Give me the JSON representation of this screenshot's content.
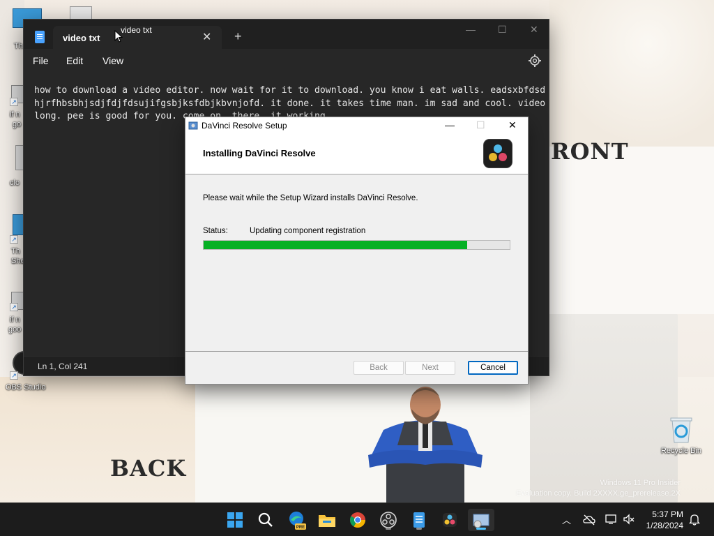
{
  "desktop": {
    "poster_front": "RONT",
    "poster_back": "BACK",
    "watermark_line1": "Windows 11 Pro Insider",
    "watermark_line2": "Evaluation copy. Build 2XXXX.ge_prerelease.2X",
    "icons": [
      {
        "label": "Th",
        "name": "desktop-icon-th"
      },
      {
        "label": "if n",
        "name": "desktop-icon-if-n-1"
      },
      {
        "label": "go",
        "name": "desktop-icon-go-1"
      },
      {
        "label": "clo",
        "name": "desktop-icon-clo"
      },
      {
        "label": "Th",
        "name": "desktop-icon-th-2"
      },
      {
        "label": "She",
        "name": "desktop-icon-she"
      },
      {
        "label": "if n",
        "name": "desktop-icon-if-n-2"
      },
      {
        "label": "goo",
        "name": "desktop-icon-goo-2"
      },
      {
        "label": "OBS Studio",
        "name": "desktop-icon-obs"
      }
    ],
    "recycle_bin_label": "Recycle Bin"
  },
  "notepad": {
    "tab_title": "video txt",
    "tooltip": "video txt",
    "menu": [
      "File",
      "Edit",
      "View"
    ],
    "content": "how to download a video editor. now wait for it to download. you know i eat walls. eadsxbfdsdhjrfhbsbhjsdjfdjfdsujifgsbjksfdbjkbvnjofd. it done. it takes time man. im sad and cool. video long. pee is good for you. come on. there. it working",
    "status": "Ln 1, Col 241"
  },
  "setup": {
    "window_title": "DaVinci Resolve Setup",
    "heading": "Installing DaVinci Resolve",
    "message": "Please wait while the Setup Wizard installs DaVinci Resolve.",
    "status_label": "Status:",
    "status_value": "Updating component registration",
    "progress": 0.86,
    "progress_color": "#06b025",
    "buttons": {
      "back": "Back",
      "next": "Next",
      "cancel": "Cancel"
    }
  },
  "taskbar": {
    "apps": [
      "start-icon",
      "search-icon",
      "edge-preview-icon",
      "file-explorer-icon",
      "chrome-icon",
      "obs-icon",
      "notepad-icon",
      "davinci-resolve-icon",
      "setup-icon"
    ],
    "edge_badge": "PRE",
    "clock_time": "5:37 PM",
    "clock_date": "1/28/2024"
  }
}
